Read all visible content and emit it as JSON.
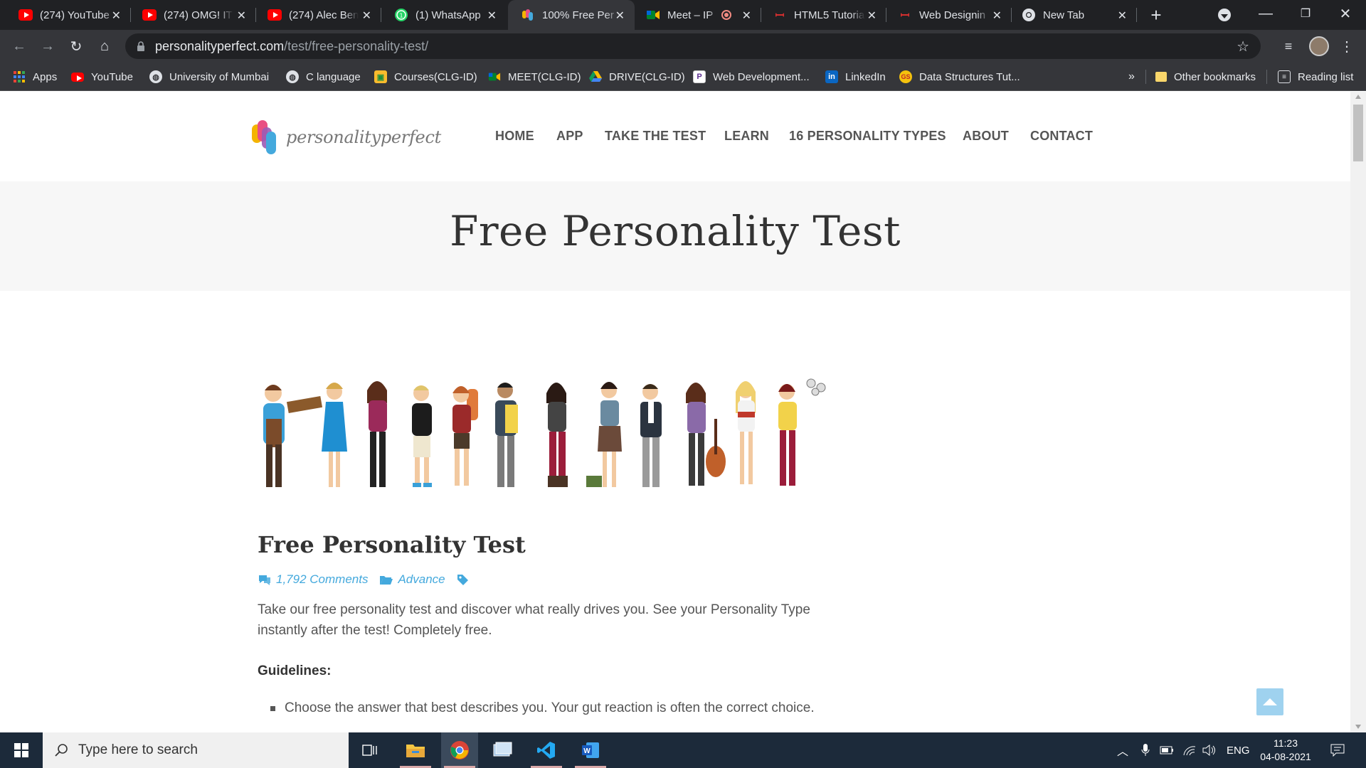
{
  "tabs": [
    {
      "title": "(274) YouTube",
      "favicon": "youtube-icon"
    },
    {
      "title": "(274) OMG! IT",
      "favicon": "youtube-icon"
    },
    {
      "title": "(274) Alec Ben",
      "favicon": "youtube-icon"
    },
    {
      "title": "(1) WhatsApp",
      "favicon": "whatsapp-icon"
    },
    {
      "title": "100% Free Per",
      "favicon": "personality-perfect-icon",
      "active": true
    },
    {
      "title": "Meet – IP",
      "favicon": "meet-icon",
      "recording": true
    },
    {
      "title": "HTML5 Tutoria",
      "favicon": "javatpoint-icon"
    },
    {
      "title": "Web Designin",
      "favicon": "javatpoint-icon"
    },
    {
      "title": "New Tab",
      "favicon": "chrome-icon"
    }
  ],
  "address": {
    "domain": "personalityperfect.com",
    "path": "/test/free-personality-test/"
  },
  "bookmarks": [
    {
      "label": "Apps",
      "icon": "apps-grid-icon"
    },
    {
      "label": "YouTube",
      "icon": "youtube-icon"
    },
    {
      "label": "University of Mumbai",
      "icon": "globe-icon"
    },
    {
      "label": "C language",
      "icon": "globe-icon"
    },
    {
      "label": "Courses(CLG-ID)",
      "icon": "classroom-icon"
    },
    {
      "label": "MEET(CLG-ID)",
      "icon": "meet-icon"
    },
    {
      "label": "DRIVE(CLG-ID)",
      "icon": "drive-icon"
    },
    {
      "label": "Web Development...",
      "icon": "p-icon"
    },
    {
      "label": "LinkedIn",
      "icon": "linkedin-icon"
    },
    {
      "label": "Data Structures Tut...",
      "icon": "gfg-icon"
    }
  ],
  "bookmarks_more": "»",
  "other_bookmarks": "Other bookmarks",
  "reading_list": "Reading list",
  "site": {
    "logo_text": "personalityperfect",
    "nav": [
      "HOME",
      "APP",
      "TAKE THE TEST",
      "LEARN",
      "16 PERSONALITY TYPES",
      "ABOUT",
      "CONTACT"
    ],
    "hero_title": "Free Personality Test"
  },
  "article": {
    "title": "Free Personality Test",
    "comments": "1,792 Comments",
    "category": "Advance",
    "intro": "Take our free personality test and discover what really drives you. See your Personality Type instantly after the test! Completely free.",
    "guidelines_heading": "Guidelines:",
    "bullet": "Choose the answer that best describes you. Your gut reaction is often the correct choice."
  },
  "taskbar": {
    "search_placeholder": "Type here to search",
    "language": "ENG",
    "time": "11:23",
    "date": "04-08-2021"
  },
  "colors": {
    "accent": "#44a9dd",
    "chrome_dark": "#202124",
    "chrome_mid": "#35363a"
  }
}
